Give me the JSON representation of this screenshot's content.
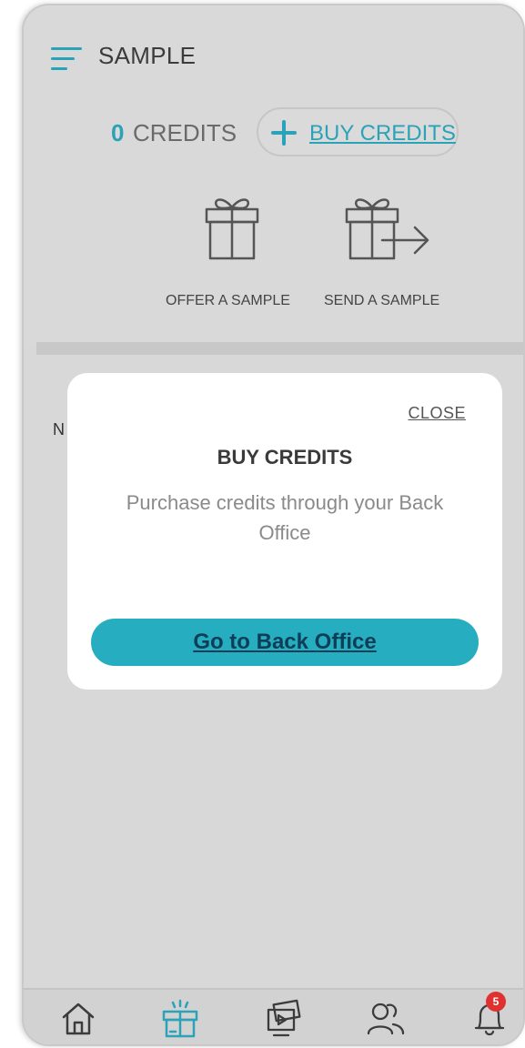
{
  "header": {
    "title": "SAMPLE",
    "credits_count": "0",
    "credits_label": "CREDITS",
    "buy_credits_label": "BUY CREDITS"
  },
  "actions": [
    {
      "label": "OFFER A SAMPLE",
      "icon": "gift-icon"
    },
    {
      "label": "SEND A SAMPLE",
      "icon": "gift-send-icon"
    }
  ],
  "background": {
    "partial_letter": "N"
  },
  "modal": {
    "close_label": "CLOSE",
    "title": "BUY CREDITS",
    "message": "Purchase credits through your Back Office",
    "button_label": "Go to Back Office"
  },
  "bottom_nav": {
    "items": [
      {
        "icon": "home-icon"
      },
      {
        "icon": "sample-gift-icon",
        "active": true
      },
      {
        "icon": "media-icon"
      },
      {
        "icon": "people-icon"
      },
      {
        "icon": "bell-icon",
        "badge": "5"
      }
    ]
  },
  "colors": {
    "accent": "#2aa3b8",
    "button": "#26aec0",
    "badge": "#e03131"
  }
}
